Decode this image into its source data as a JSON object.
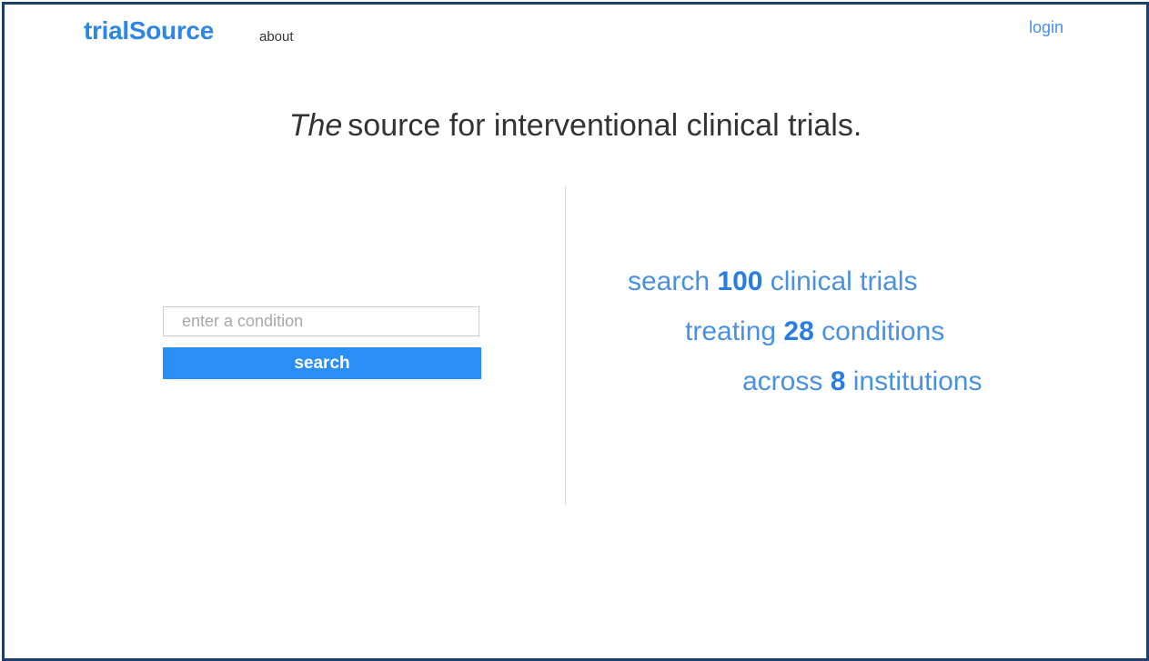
{
  "header": {
    "brand": "trialSource",
    "nav_about": "about",
    "nav_login": "login"
  },
  "hero": {
    "tagline_em": "The",
    "tagline_rest": "source for interventional clinical trials."
  },
  "search": {
    "placeholder": "enter a condition",
    "button_label": "search"
  },
  "stats": {
    "line1_prefix": "search",
    "line1_number": "100",
    "line1_suffix": "clinical trials",
    "line2_prefix": "treating",
    "line2_number": "28",
    "line2_suffix": "conditions",
    "line3_prefix": "across",
    "line3_number": "8",
    "line3_suffix": "institutions"
  },
  "colors": {
    "brand": "#2b86e6",
    "accent": "#2a8ef7",
    "stat_text": "#4a90e2",
    "frame_border": "#1f3f6b"
  }
}
